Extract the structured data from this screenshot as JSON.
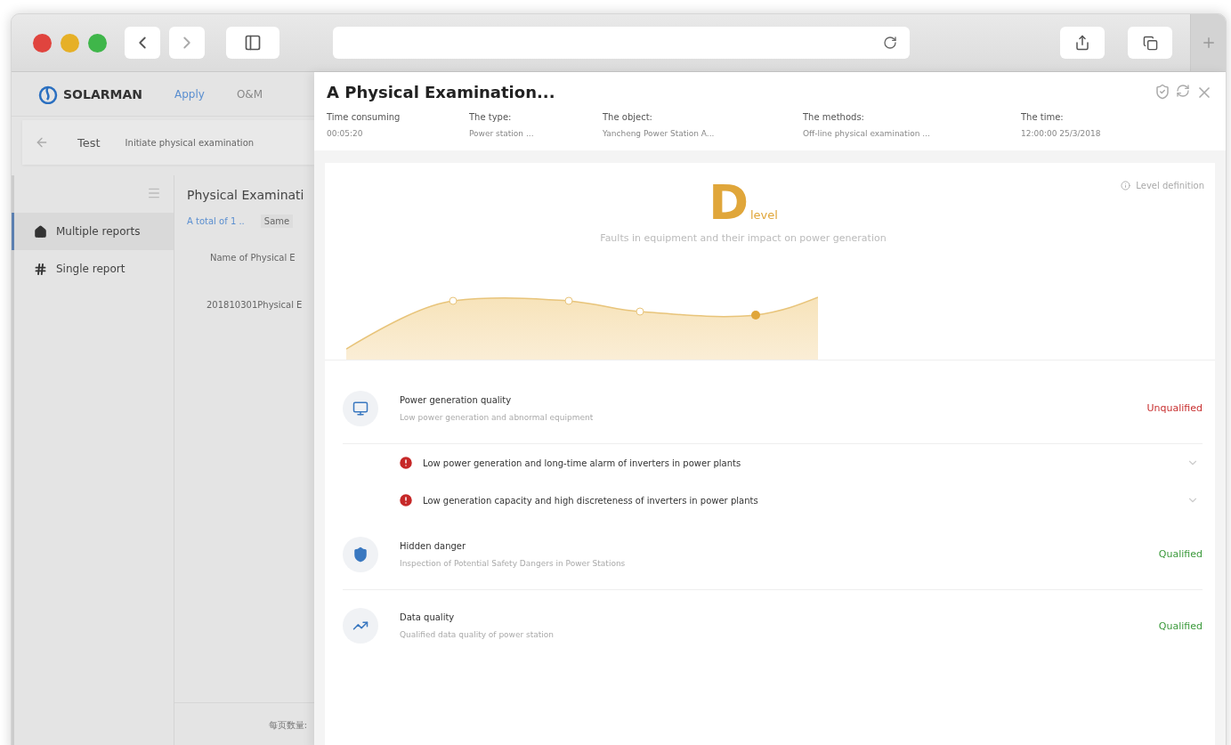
{
  "app": {
    "logo": "SOLARMAN",
    "nav": [
      {
        "label": "Apply",
        "selected": true
      },
      {
        "label": "O&M",
        "selected": false
      }
    ],
    "breadcrumb": {
      "title": "Test",
      "action": "Initiate physical examination"
    },
    "sidebar": [
      {
        "kind": "home",
        "label": "Multiple reports",
        "selected": true
      },
      {
        "kind": "grid",
        "label": "Single report",
        "selected": false
      }
    ],
    "list": {
      "title": "Physical Examinati",
      "total": "A total of 1 ..",
      "filter": "Same",
      "column": "Name of Physical E",
      "rows": [
        "201810301Physical E"
      ],
      "footer": "每页数量:"
    }
  },
  "drawer": {
    "title": "A Physical Examination...",
    "meta": [
      {
        "label": "Time consuming",
        "value": "00:05:20"
      },
      {
        "label": "The type:",
        "value": "Power station ..."
      },
      {
        "label": "The object:",
        "value": "Yancheng Power Station A..."
      },
      {
        "label": "The methods:",
        "value": "Off-line physical examination ..."
      },
      {
        "label": "The time:",
        "value": "12:00:00  25/3/2018"
      }
    ],
    "grade": {
      "letter": "D",
      "suffix": "level",
      "description": "Faults in equipment and their impact on power generation",
      "definition": "Level definition"
    },
    "checks": [
      {
        "kind": "generation",
        "title": "Power generation quality",
        "subtitle": "Low power generation and abnormal equipment",
        "status": "Unqualified",
        "qualified": false,
        "children": [
          {
            "text": "Low power generation and long-time alarm of inverters in power plants"
          },
          {
            "text": "Low generation capacity and high discreteness of inverters in power plants"
          }
        ]
      },
      {
        "kind": "safety",
        "title": "Hidden danger",
        "subtitle": "Inspection of Potential Safety Dangers in Power Stations",
        "status": "Qualified",
        "qualified": true
      },
      {
        "kind": "data",
        "title": "Data quality",
        "subtitle": "Qualified data quality of power station",
        "status": "Qualified",
        "qualified": true
      }
    ]
  }
}
